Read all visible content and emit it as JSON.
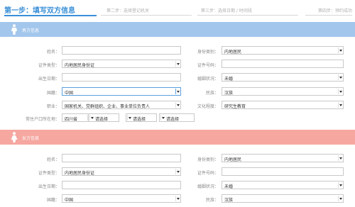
{
  "steps": {
    "active": "第一步：填写双方信息",
    "step2": "第二步：选择登记机关",
    "step3": "第三步：选择日期 / 时间段",
    "step4": "第四步：预约成功"
  },
  "sections": {
    "groom": {
      "title": "男方信息",
      "icon": "male-person-icon",
      "color": "#a3c6ec"
    },
    "bride": {
      "title": "女方信息",
      "icon": "female-person-icon",
      "color": "#f5a7a0"
    }
  },
  "labels": {
    "name": "姓名：",
    "id_type": "证件类型：",
    "birth": "出生日期：",
    "nationality": "国籍：",
    "occupation": "职业：",
    "residence": "常住户口所在地：",
    "identity": "身份类别：",
    "id_number": "证件号码：",
    "marital": "婚姻状况：",
    "ethnicity": "民族：",
    "education": "文化程度："
  },
  "groom": {
    "name": "",
    "id_type": "内地居民身份证",
    "birth": "",
    "nationality": "中国",
    "occupation": "国家机关、党群组织、企业、事业单位负责人",
    "residence": {
      "province": "四川省",
      "city": "请选择",
      "district": "请选择",
      "street": "请选择"
    },
    "identity": "内地居民",
    "id_number": "",
    "marital": "未婚",
    "ethnicity": "汉族",
    "education": "研究生教育"
  },
  "bride": {
    "name": "",
    "id_type": "内地居民身份证",
    "birth": "",
    "nationality": "中国",
    "identity": "内地居民",
    "id_number": "",
    "marital": "未婚",
    "ethnicity": "汉族"
  },
  "colors": {
    "accent": "#3a8fd6",
    "groom_header": "#a3c6ec",
    "bride_header": "#f5a7a0"
  }
}
